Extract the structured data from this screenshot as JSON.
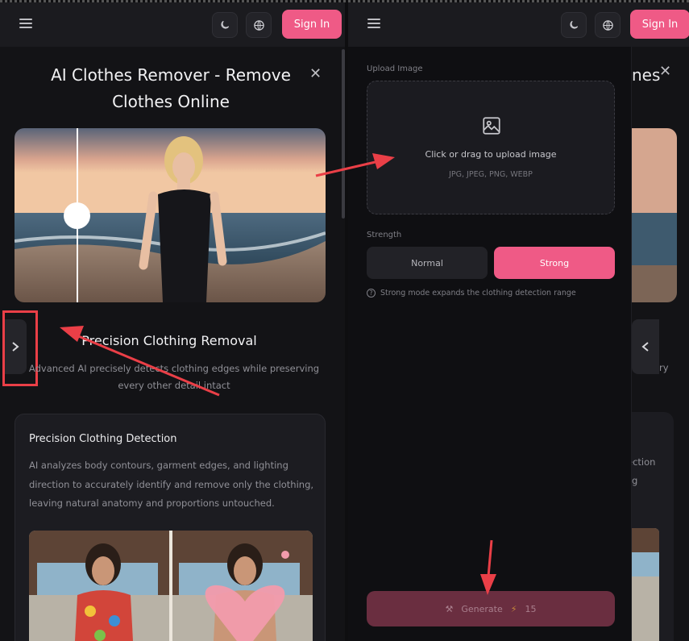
{
  "left_panel": {
    "header": {
      "signin_label": "Sign In"
    },
    "title": "AI Clothes Remover - Remove Clothes Online",
    "feature": {
      "heading": "Precision Clothing Removal",
      "description": "Advanced AI precisely detects clothing edges while preserving every other detail intact"
    },
    "card": {
      "title": "Precision Clothing Detection",
      "text": "AI analyzes body contours, garment edges, and lighting direction to accurately identify and remove only the clothing, leaving natural anatomy and proportions untouched."
    }
  },
  "right_panel": {
    "header": {
      "signin_label": "Sign In"
    },
    "ghost": {
      "title_fragment": "nes",
      "text_fragment": "ry",
      "card_fragment_1": "ection",
      "card_fragment_2": "g"
    },
    "sheet": {
      "upload_label": "Upload Image",
      "upload_main": "Click or drag to upload image",
      "upload_formats": "JPG, JPEG, PNG, WEBP",
      "strength_label": "Strength",
      "strength_options": [
        "Normal",
        "Strong"
      ],
      "selected_strength": "Strong",
      "strength_hint": "Strong mode expands the clothing detection range",
      "generate_label": "Generate",
      "generate_cost": "15"
    }
  },
  "colors": {
    "accent": "#ef5a86",
    "annotation": "#ea3f47",
    "background": "#131316"
  },
  "icons": [
    "menu-icon",
    "moon-icon",
    "globe-icon",
    "close-icon",
    "chevron-right-icon",
    "chevron-left-icon",
    "image-icon",
    "info-icon",
    "hammer-icon",
    "lightning-icon"
  ]
}
